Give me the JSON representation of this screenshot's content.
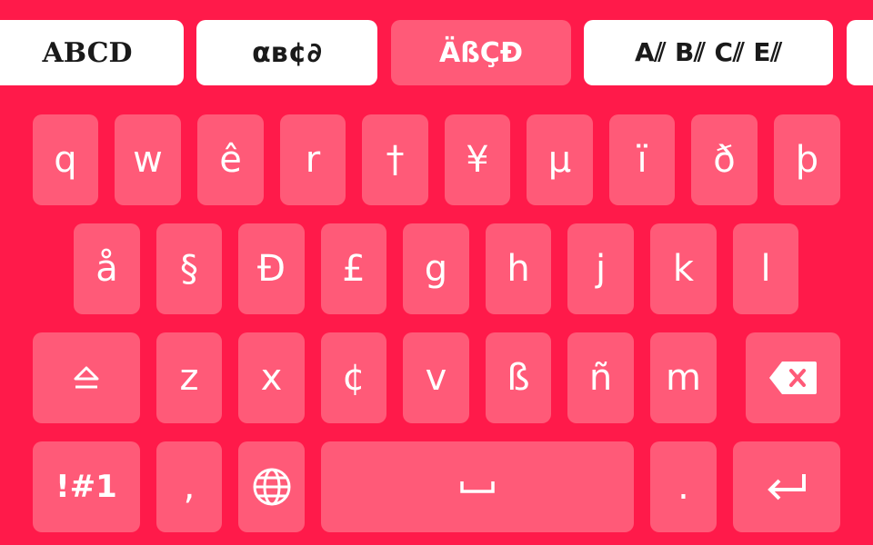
{
  "font_strip": {
    "chips": [
      {
        "label": "ABCD",
        "selected": false
      },
      {
        "label": "αв¢∂",
        "selected": false
      },
      {
        "label": "ÄßÇĐ",
        "selected": true
      },
      {
        "label": "A⫽ B⫽ C⫽ E⫽",
        "selected": false
      },
      {
        "label": "",
        "selected": false
      }
    ]
  },
  "keyboard": {
    "row1": [
      "q",
      "w",
      "ê",
      "r",
      "†",
      "¥",
      "µ",
      "ï",
      "ð",
      "þ"
    ],
    "row2": [
      "å",
      "§",
      "Đ",
      "£",
      "g",
      "h",
      "j",
      "k",
      "l"
    ],
    "row3": [
      "z",
      "x",
      "¢",
      "v",
      "ß",
      "ñ",
      "m"
    ],
    "shift_icon": "shift-icon",
    "backspace_icon": "backspace-icon",
    "symbols_label": "!#1",
    "comma_label": ",",
    "globe_icon": "globe-icon",
    "space_icon": "space-bar-icon",
    "period_label": ".",
    "enter_icon": "enter-icon"
  },
  "colors": {
    "background": "#FF1A4A",
    "key": "#FF5A78",
    "key_text": "#FFFFFF",
    "chip": "#FFFFFF",
    "chip_selected": "#FF5A78"
  }
}
